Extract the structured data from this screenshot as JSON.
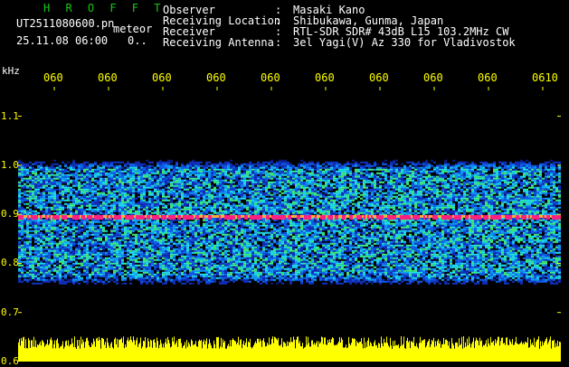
{
  "header": {
    "brand": "H R O F F T",
    "filename": "UT2511080600.pn",
    "mode": "meteor",
    "timestamp": "25.11.08 06:00",
    "counter": "0..",
    "info": [
      {
        "label": "Observer",
        "value": "Masaki Kano"
      },
      {
        "label": "Receiving Location",
        "value": "Shibukawa, Gunma, Japan"
      },
      {
        "label": "Receiver",
        "value": "RTL-SDR SDR# 43dB L15 103.2MHz CW"
      },
      {
        "label": "Receiving Antenna",
        "value": "3el Yagi(V) Az 330 for Vladivostok"
      }
    ]
  },
  "colors": {
    "brand": "#18c818",
    "axis_labels": "#ffff00",
    "header_text": "#ffffff",
    "echo_line": "#ff2080",
    "signal_level": "#ffff00"
  },
  "chart_data": {
    "type": "heatmap",
    "y_unit": "kHz",
    "y_ticks": [
      "1.1",
      "1.0",
      "0.9",
      "0.8",
      "0.7",
      "0.6"
    ],
    "ylim": [
      0.6,
      1.16
    ],
    "x_ticks": [
      "060",
      "060",
      "060",
      "060",
      "060",
      "060",
      "060",
      "060",
      "060",
      "0610"
    ],
    "noise_band": [
      0.755,
      1.015
    ],
    "signal_line": 0.895
  }
}
